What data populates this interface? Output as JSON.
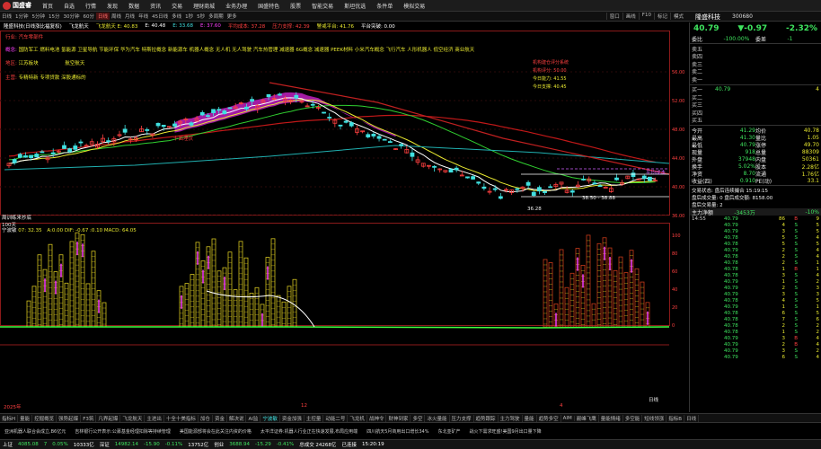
{
  "menubar": {
    "app_name": "国盛睿",
    "items": [
      "首页",
      "自选",
      "行情",
      "发现",
      "数据",
      "资讯",
      "交易",
      "理财商城",
      "业务办理",
      "国盛特色",
      "股票",
      "智能交易",
      "斯坦优选",
      "条件单",
      "模拟交易"
    ]
  },
  "periods": [
    "日线",
    "1分钟",
    "5分钟",
    "15分",
    "30分钟",
    "60分",
    "日线",
    "周线",
    "月线",
    "年线",
    "45日线",
    "多线",
    "1秒",
    "5秒",
    "多周期",
    "更多"
  ],
  "active_period_index": 6,
  "right_tools": [
    "窗口",
    "画线",
    "F10",
    "标记",
    "模式"
  ],
  "symbol": {
    "name": "隆盛科技",
    "code": "300680"
  },
  "infobar": [
    {
      "text": "隆盛科技(日线涨比福复权)",
      "color": "#ffffff"
    },
    {
      "text": "飞龙航天",
      "color": "#ffffff"
    },
    {
      "text": "飞龙航天 E: 40.83",
      "color": "#e8e830"
    },
    {
      "text": "E: 40.48",
      "color": "#ffffff"
    },
    {
      "text": "E: 33.68",
      "color": "#40e0e0"
    },
    {
      "text": "E: 37.60",
      "color": "#ff40ff"
    },
    {
      "text": "平均成本: 37.28",
      "color": "#ff4040"
    },
    {
      "text": "压力支撑: 42.39",
      "color": "#ff4040"
    },
    {
      "text": "警戒平台: 41.76",
      "color": "#e8e830"
    },
    {
      "text": "平台突破: 0.00",
      "color": "#ffffff"
    }
  ],
  "overlay": {
    "industry_label": "行业:",
    "industry_value": "汽车零部件",
    "concept_label": "概念:",
    "concepts": "国防军工 燃料电池 氢能源 卫星导航 节能环保 华为汽车 特斯拉概念 新能源车 机器人概念 无人机 无人驾驶 汽车热管理 减速器 6G概念 减速器 PEEK材料 小米汽车概念 飞行汽车 人形机器人 低空经济 商业航天",
    "region_label": "地区:",
    "region_value": "江苏板块",
    "flag": "航空航天",
    "main_label": "主营:",
    "main_value": "专精特新 专项贷款 深股通标的",
    "sys_title": "机构建仓评分系统",
    "sys_lines": [
      "机构评分: 50.00",
      "今日能力: 41.55",
      "今日支撑: 40.45"
    ],
    "sys_colors": [
      "#ff4040",
      "#e8e830",
      "#e8e830"
    ],
    "low_label": "36.28",
    "box_label": "38.50 - 38.88",
    "red_label": "十面埋伏",
    "cost_tag": "平均成本",
    "ind_name": "宁波敏",
    "ind_value": "07: 32.35",
    "macd_line": "A:0.00 DIF: -0.67 :0.10 MACD: 64.05",
    "sub_label1": "周训练来抄底",
    "sub_label2": "100天",
    "date_left": "2025年",
    "date_mid": "12",
    "date_right": "4",
    "axis_tag": "日线"
  },
  "price_axis": [
    "56.00",
    "52.00",
    "48.00",
    "44.00",
    "40.00",
    "36.00"
  ],
  "sub_axis": [
    "100",
    "80",
    "60",
    "40",
    "20",
    "0"
  ],
  "right_panel": {
    "price": "40.79",
    "change": "▼-0.97",
    "pct": "-2.32%",
    "webi_label": "委比",
    "webi": "-100.00%",
    "webi_diff_label": "委差",
    "webi_diff": "-1",
    "sells": [
      {
        "label": "卖五",
        "price": "",
        "vol": ""
      },
      {
        "label": "卖四",
        "price": "",
        "vol": ""
      },
      {
        "label": "卖三",
        "price": "",
        "vol": ""
      },
      {
        "label": "卖二",
        "price": "",
        "vol": ""
      },
      {
        "label": "卖一",
        "price": "",
        "vol": ""
      }
    ],
    "buys": [
      {
        "label": "买一",
        "price": "40.79",
        "vol": "4"
      },
      {
        "label": "买二",
        "price": "",
        "vol": ""
      },
      {
        "label": "买三",
        "price": "",
        "vol": ""
      },
      {
        "label": "买四",
        "price": "",
        "vol": ""
      },
      {
        "label": "买五",
        "price": "",
        "vol": ""
      }
    ],
    "stats": [
      [
        "今开",
        "41.29",
        "均价",
        "40.78"
      ],
      [
        "最高",
        "41.30",
        "量比",
        "1.05"
      ],
      [
        "最低",
        "40.79",
        "涨停",
        "49.70"
      ],
      [
        "现量",
        "918",
        "总量",
        "88309"
      ],
      [
        "外盘",
        "37948",
        "内盘",
        "50361"
      ],
      [
        "换手",
        "5.02%",
        "股本",
        "2.28亿"
      ],
      [
        "净资",
        "8.70",
        "流通",
        "1.76亿"
      ],
      [
        "收益(四)",
        "0.910",
        "PE(动)",
        "33.1"
      ]
    ],
    "status_text": "交易状态: 盘后连续撮合 15:19:15",
    "after_text": "盘后成交量: 0 盘后成交额: 8158.00",
    "afterlast_text": "盘后交易量: 2",
    "flow_label": "主力净额",
    "flow_value": "-3453万",
    "flow_pct": "-10%",
    "trades": [
      [
        "14:55",
        "40.79",
        "1",
        "B",
        "1"
      ],
      [
        "",
        "40.79",
        "",
        "S",
        ""
      ],
      [
        "",
        "40.79",
        "",
        "S",
        ""
      ],
      [
        "",
        "40.78",
        "",
        "S",
        ""
      ],
      [
        "",
        "40.78",
        "",
        "S",
        ""
      ],
      [
        "",
        "40.79",
        "",
        "S",
        ""
      ],
      [
        "",
        "40.78",
        "",
        "S",
        ""
      ],
      [
        "",
        "40.78",
        "",
        "S",
        ""
      ],
      [
        "",
        "40.78",
        "",
        "B",
        ""
      ],
      [
        "",
        "40.78",
        "",
        "S",
        ""
      ],
      [
        "",
        "40.79",
        "",
        "S",
        ""
      ],
      [
        "",
        "40.79",
        "",
        "S",
        ""
      ],
      [
        "",
        "40.79",
        "",
        "S",
        ""
      ],
      [
        "",
        "40.78",
        "",
        "S",
        ""
      ],
      [
        "",
        "40.79",
        "",
        "S",
        ""
      ],
      [
        "",
        "40.78",
        "",
        "S",
        ""
      ],
      [
        "",
        "40.78",
        "",
        "S",
        ""
      ],
      [
        "",
        "40.78",
        "",
        "S",
        ""
      ],
      [
        "",
        "40.78",
        "",
        "S",
        ""
      ],
      [
        "",
        "40.79",
        "",
        "B",
        ""
      ],
      [
        "",
        "40.79",
        "",
        "B",
        ""
      ],
      [
        "",
        "40.79",
        "",
        "S",
        ""
      ],
      [
        "",
        "40.79",
        "",
        "S",
        ""
      ]
    ],
    "trade_vols": [
      "86",
      "4",
      "3",
      "5",
      "5",
      "2",
      "2",
      "2",
      "1",
      "3",
      "1",
      "2",
      "3",
      "4",
      "1",
      "6",
      "7",
      "2",
      "1",
      "3",
      "2",
      "3",
      "6"
    ],
    "trade_nums": [
      "9",
      "5",
      "5",
      "4",
      "5",
      "4",
      "4",
      "1",
      "1",
      "4",
      "2",
      "3",
      "3",
      "5",
      "1",
      "5",
      "6",
      "2",
      "2",
      "4",
      "4",
      "2",
      "4"
    ]
  },
  "ind_tabs": [
    "指标H",
    "量能",
    "控掘概览",
    "强势起爆",
    "F3筑",
    "凡界起爆",
    "飞龙航天",
    "主进出",
    "十全十美指标",
    "加仓",
    "资金",
    "解决说",
    "AI监",
    "宁波敏",
    "资金加强",
    "主控量",
    "动能二号",
    "飞龙机",
    "战神令",
    "财神到家",
    "多空",
    "冰火量能",
    "压力支撑",
    "趋势跟踪",
    "主力驾驶",
    "量能",
    "趋势多空",
    "AIM",
    "巅峰飞鹰",
    "量能情绪",
    "多空能",
    "短线领涨",
    "指标B",
    "日线"
  ],
  "active_ind_tab_index": 13,
  "news": [
    "亚洲机器人联合会成立,B6亿元",
    "吉林银行公开表示:公募基金经理扣除等持续管理",
    "美国能源部将会在此关注内资的价格",
    "太平洋证券:机器人行业正在快速发展,布局应用端",
    "四川航天5月商用出口增长34%",
    "东北亚矿产",
    "战火下需求旺盛!美国9月出口量下降"
  ],
  "status": [
    {
      "text": "上证",
      "color": "#ffffff"
    },
    {
      "text": "4085.08",
      "color": "#3ee45e"
    },
    {
      "text": "7",
      "color": "#3ee45e"
    },
    {
      "text": "0.05%",
      "color": "#3ee45e"
    },
    {
      "text": "10333亿",
      "color": "#ffffff"
    },
    {
      "text": "深证",
      "color": "#ffffff"
    },
    {
      "text": "14982.14",
      "color": "#3ee45e"
    },
    {
      "text": "-15.90",
      "color": "#3ee45e"
    },
    {
      "text": "-0.11%",
      "color": "#3ee45e"
    },
    {
      "text": "13752亿",
      "color": "#ffffff"
    },
    {
      "text": "创业",
      "color": "#ffffff"
    },
    {
      "text": "3688.94",
      "color": "#3ee45e"
    },
    {
      "text": "-15.29",
      "color": "#3ee45e"
    },
    {
      "text": "-0.41%",
      "color": "#3ee45e"
    },
    {
      "text": "总成交 24268亿",
      "color": "#ffffff"
    },
    {
      "text": "已连接",
      "color": "#ffffff"
    },
    {
      "text": "15:20:19",
      "color": "#ffffff"
    }
  ]
}
